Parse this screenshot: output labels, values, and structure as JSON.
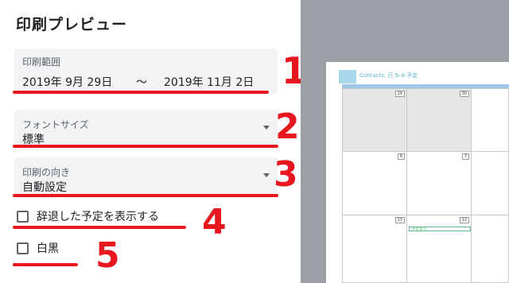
{
  "title": "印刷プレビュー",
  "range": {
    "label": "印刷範囲",
    "start": "2019年 9月 29日",
    "separator": "～",
    "end": "2019年 11月 2日"
  },
  "font_size": {
    "label": "フォントサイズ",
    "value": "標準"
  },
  "orientation": {
    "label": "印刷の向き",
    "value": "自動設定"
  },
  "declined": {
    "label": "辞退した予定を表示する",
    "checked": false
  },
  "bw": {
    "label": "白黒",
    "checked": false
  },
  "annotations": [
    "1",
    "2",
    "3",
    "4",
    "5"
  ],
  "annotation_color": "#e8171f",
  "preview": {
    "header_text": "Contacts, 日 9–8 予定",
    "day_numbers": [
      "29",
      "30",
      "6",
      "7",
      "13",
      "12"
    ],
    "event_label": "予定あり"
  }
}
